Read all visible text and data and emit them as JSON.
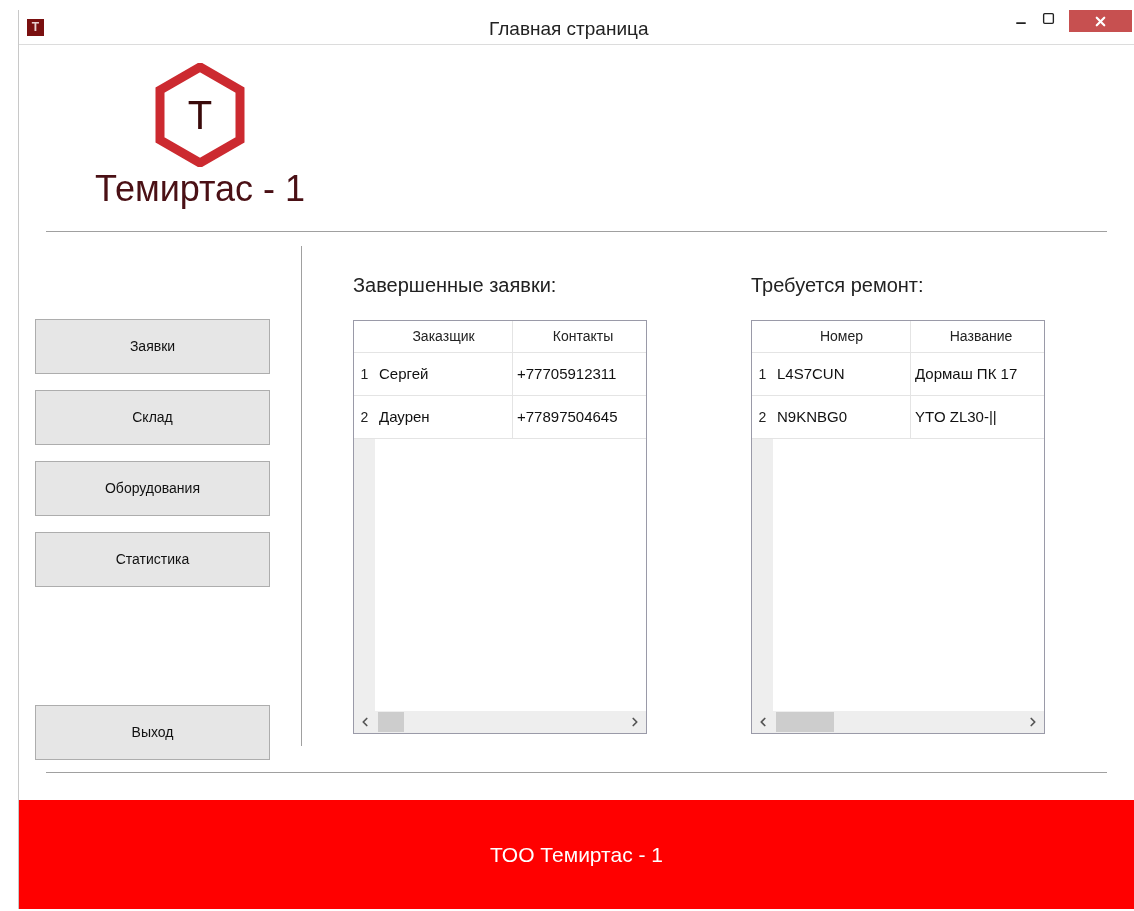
{
  "window": {
    "icon_letter": "T",
    "title": "Главная страница"
  },
  "logo": {
    "mark_letter": "Т",
    "name": "Темиртас - 1"
  },
  "nav": [
    {
      "label": "Заявки"
    },
    {
      "label": "Склад"
    },
    {
      "label": "Оборудования"
    },
    {
      "label": "Статистика"
    }
  ],
  "exit_button": {
    "label": "Выход"
  },
  "tables": [
    {
      "title": "Завершенные заявки:",
      "columns": [
        "Заказщик",
        "Контакты"
      ],
      "rows": [
        {
          "number": "1",
          "cells": [
            "Сергей",
            "+77705912311"
          ]
        },
        {
          "number": "2",
          "cells": [
            "Даурен",
            "+77897504645"
          ]
        }
      ]
    },
    {
      "title": "Требуется ремонт:",
      "columns": [
        "Номер",
        "Название"
      ],
      "rows": [
        {
          "number": "1",
          "cells": [
            "L4S7CUN",
            "Дормаш ПК 17"
          ]
        },
        {
          "number": "2",
          "cells": [
            "N9KNBG0",
            "YTO ZL30-||"
          ]
        }
      ]
    }
  ],
  "footer": {
    "text": "ТОО Темиртас - 1"
  }
}
